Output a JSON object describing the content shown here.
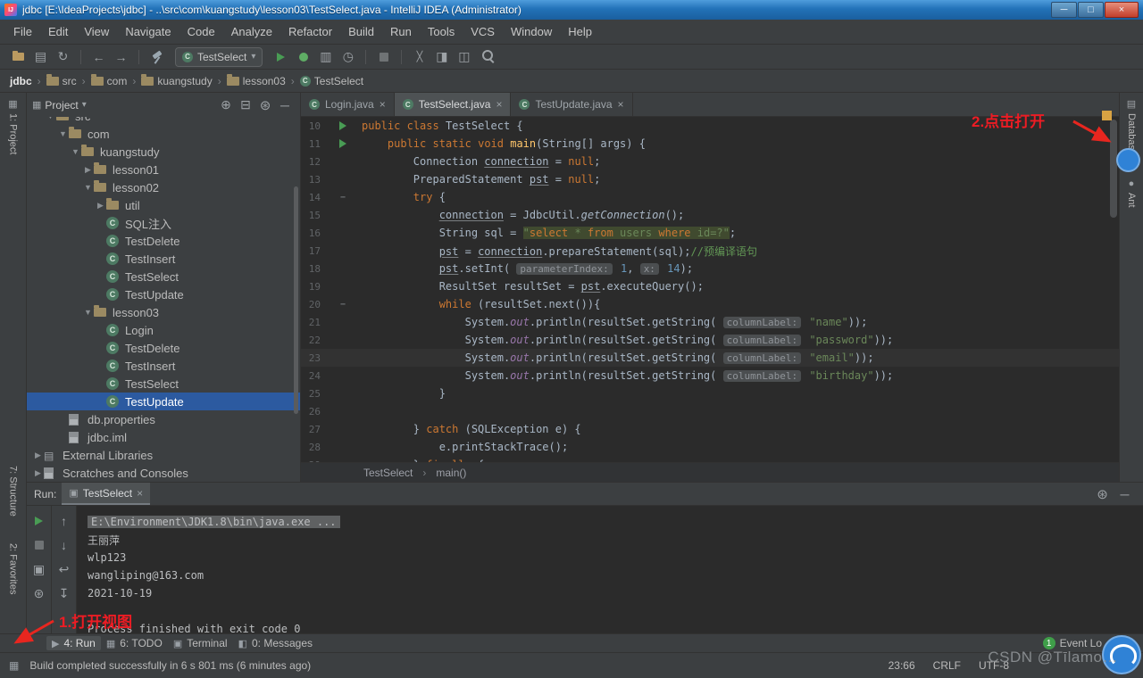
{
  "titlebar": {
    "title": "jdbc [E:\\IdeaProjects\\jdbc] - ..\\src\\com\\kuangstudy\\lesson03\\TestSelect.java - IntelliJ IDEA (Administrator)"
  },
  "menubar": {
    "items": [
      "File",
      "Edit",
      "View",
      "Navigate",
      "Code",
      "Analyze",
      "Refactor",
      "Build",
      "Run",
      "Tools",
      "VCS",
      "Window",
      "Help"
    ]
  },
  "toolbar": {
    "left_icons": [
      "open-folder-icon",
      "save-all-icon",
      "sync-icon"
    ],
    "nav_icons": [
      "back-icon",
      "forward-icon"
    ],
    "build_icons": [
      "hammer-icon"
    ],
    "run_config": "TestSelect",
    "run_icons": [
      "run-icon",
      "debug-icon",
      "coverage-icon",
      "profiler-icon"
    ],
    "stop_icons": [
      "stop-icon"
    ],
    "right_icons": [
      "screwdriver-icon",
      "diff-icon",
      "layout-icon",
      "search-icon"
    ]
  },
  "navbar": {
    "items": [
      {
        "label": "jdbc",
        "icon": "project"
      },
      {
        "label": "src",
        "icon": "folder"
      },
      {
        "label": "com",
        "icon": "folder"
      },
      {
        "label": "kuangstudy",
        "icon": "folder"
      },
      {
        "label": "lesson03",
        "icon": "folder"
      },
      {
        "label": "TestSelect",
        "icon": "class"
      }
    ]
  },
  "left_strip": {
    "items": [
      "1: Project",
      "7: Structure",
      "2: Favorites"
    ]
  },
  "right_strip": {
    "items": [
      "Database",
      "Ant"
    ]
  },
  "project_panel": {
    "title": "Project",
    "header_icons": [
      "locate-icon",
      "collapse-all-icon",
      "gear-icon",
      "hide-icon"
    ],
    "tree": [
      {
        "label": "src",
        "level": 2,
        "arrow": "down",
        "icon": "folder",
        "clipped": true
      },
      {
        "label": "com",
        "level": 3,
        "arrow": "down",
        "icon": "folder"
      },
      {
        "label": "kuangstudy",
        "level": 4,
        "arrow": "down",
        "icon": "folder"
      },
      {
        "label": "lesson01",
        "level": 5,
        "arrow": "right",
        "icon": "folder"
      },
      {
        "label": "lesson02",
        "level": 5,
        "arrow": "down",
        "icon": "folder"
      },
      {
        "label": "util",
        "level": 6,
        "arrow": "right",
        "icon": "folder"
      },
      {
        "label": "SQL注入",
        "level": 6,
        "arrow": "none",
        "icon": "class"
      },
      {
        "label": "TestDelete",
        "level": 6,
        "arrow": "none",
        "icon": "class"
      },
      {
        "label": "TestInsert",
        "level": 6,
        "arrow": "none",
        "icon": "class"
      },
      {
        "label": "TestSelect",
        "level": 6,
        "arrow": "none",
        "icon": "class"
      },
      {
        "label": "TestUpdate",
        "level": 6,
        "arrow": "none",
        "icon": "class"
      },
      {
        "label": "lesson03",
        "level": 5,
        "arrow": "down",
        "icon": "folder"
      },
      {
        "label": "Login",
        "level": 6,
        "arrow": "none",
        "icon": "class"
      },
      {
        "label": "TestDelete",
        "level": 6,
        "arrow": "none",
        "icon": "class"
      },
      {
        "label": "TestInsert",
        "level": 6,
        "arrow": "none",
        "icon": "class"
      },
      {
        "label": "TestSelect",
        "level": 6,
        "arrow": "none",
        "icon": "class"
      },
      {
        "label": "TestUpdate",
        "level": 6,
        "arrow": "none",
        "icon": "class",
        "selected": true
      },
      {
        "label": "db.properties",
        "level": 3,
        "arrow": "none",
        "icon": "file"
      },
      {
        "label": "jdbc.iml",
        "level": 3,
        "arrow": "none",
        "icon": "file"
      },
      {
        "label": "External Libraries",
        "level": 1,
        "arrow": "right",
        "icon": "lib"
      },
      {
        "label": "Scratches and Consoles",
        "level": 1,
        "arrow": "right",
        "icon": "file"
      }
    ]
  },
  "editor": {
    "tabs": [
      {
        "label": "Login.java",
        "active": false
      },
      {
        "label": "TestSelect.java",
        "active": true
      },
      {
        "label": "TestUpdate.java",
        "active": false
      }
    ],
    "breadcrumb": [
      "TestSelect",
      "main()"
    ],
    "lines": [
      {
        "no": 10,
        "g": "run",
        "segs": [
          [
            "k",
            "public"
          ],
          [
            "p",
            " "
          ],
          [
            "k",
            "class"
          ],
          [
            "p",
            " TestSelect {"
          ]
        ]
      },
      {
        "no": 11,
        "g": "run",
        "segs": [
          [
            "p",
            "    "
          ],
          [
            "k",
            "public"
          ],
          [
            "p",
            " "
          ],
          [
            "k",
            "static"
          ],
          [
            "p",
            " "
          ],
          [
            "k",
            "void"
          ],
          [
            "p",
            " "
          ],
          [
            "m",
            "main"
          ],
          [
            "p",
            "(String[] args) {"
          ]
        ]
      },
      {
        "no": 12,
        "g": "",
        "segs": [
          [
            "p",
            "        Connection "
          ],
          [
            "u",
            "connection"
          ],
          [
            "p",
            " = "
          ],
          [
            "k",
            "null"
          ],
          [
            "p",
            ";"
          ]
        ]
      },
      {
        "no": 13,
        "g": "",
        "segs": [
          [
            "p",
            "        PreparedStatement "
          ],
          [
            "u",
            "pst"
          ],
          [
            "p",
            " = "
          ],
          [
            "k",
            "null"
          ],
          [
            "p",
            ";"
          ]
        ]
      },
      {
        "no": 14,
        "g": "fold",
        "segs": [
          [
            "p",
            "        "
          ],
          [
            "k",
            "try"
          ],
          [
            "p",
            " {"
          ]
        ]
      },
      {
        "no": 15,
        "g": "",
        "segs": [
          [
            "p",
            "            "
          ],
          [
            "u",
            "connection"
          ],
          [
            "p",
            " = JdbcUtil."
          ],
          [
            "i",
            "getConnection"
          ],
          [
            "p",
            "();"
          ]
        ]
      },
      {
        "no": 16,
        "g": "",
        "segs": [
          [
            "p",
            "            String sql = "
          ],
          [
            "ss",
            "\""
          ],
          [
            "skw",
            "select"
          ],
          [
            "ss",
            " * "
          ],
          [
            "skw",
            "from"
          ],
          [
            "ss",
            " users "
          ],
          [
            "skw",
            "where"
          ],
          [
            "ss",
            " id=?\""
          ],
          [
            "p",
            ";"
          ]
        ]
      },
      {
        "no": 17,
        "g": "",
        "segs": [
          [
            "p",
            "            "
          ],
          [
            "u",
            "pst"
          ],
          [
            "p",
            " = "
          ],
          [
            "u",
            "connection"
          ],
          [
            "p",
            ".prepareStatement(sql);"
          ],
          [
            "c",
            "//预编译语句"
          ]
        ]
      },
      {
        "no": 18,
        "g": "",
        "segs": [
          [
            "p",
            "            "
          ],
          [
            "u",
            "pst"
          ],
          [
            "p",
            ".setInt( "
          ],
          [
            "h",
            "parameterIndex:"
          ],
          [
            "p",
            " "
          ],
          [
            "n",
            "1"
          ],
          [
            "p",
            ", "
          ],
          [
            "h",
            "x:"
          ],
          [
            "p",
            " "
          ],
          [
            "n",
            "14"
          ],
          [
            "p",
            ");"
          ]
        ]
      },
      {
        "no": 19,
        "g": "",
        "segs": [
          [
            "p",
            "            ResultSet resultSet = "
          ],
          [
            "u",
            "pst"
          ],
          [
            "p",
            ".executeQuery();"
          ]
        ]
      },
      {
        "no": 20,
        "g": "fold",
        "segs": [
          [
            "p",
            "            "
          ],
          [
            "k",
            "while"
          ],
          [
            "p",
            " (resultSet.next()){"
          ]
        ]
      },
      {
        "no": 21,
        "g": "",
        "segs": [
          [
            "p",
            "                System."
          ],
          [
            "f",
            "out"
          ],
          [
            "p",
            ".println(resultSet.getString( "
          ],
          [
            "h",
            "columnLabel:"
          ],
          [
            "p",
            " "
          ],
          [
            "s",
            "\"name\""
          ],
          [
            "p",
            "));"
          ]
        ]
      },
      {
        "no": 22,
        "g": "",
        "segs": [
          [
            "p",
            "                System."
          ],
          [
            "f",
            "out"
          ],
          [
            "p",
            ".println(resultSet.getString( "
          ],
          [
            "h",
            "columnLabel:"
          ],
          [
            "p",
            " "
          ],
          [
            "s",
            "\"password\""
          ],
          [
            "p",
            "));"
          ]
        ]
      },
      {
        "no": 23,
        "g": "",
        "cur": true,
        "segs": [
          [
            "p",
            "                System."
          ],
          [
            "f",
            "out"
          ],
          [
            "p",
            ".println(resultSet.getString( "
          ],
          [
            "h",
            "columnLabel:"
          ],
          [
            "p",
            " "
          ],
          [
            "s",
            "\"email\""
          ],
          [
            "p",
            "));"
          ]
        ]
      },
      {
        "no": 24,
        "g": "",
        "segs": [
          [
            "p",
            "                System."
          ],
          [
            "f",
            "out"
          ],
          [
            "p",
            ".println(resultSet.getString( "
          ],
          [
            "h",
            "columnLabel:"
          ],
          [
            "p",
            " "
          ],
          [
            "s",
            "\"birthday\""
          ],
          [
            "p",
            "));"
          ]
        ]
      },
      {
        "no": 25,
        "g": "",
        "segs": [
          [
            "p",
            "            }"
          ]
        ]
      },
      {
        "no": 26,
        "g": "",
        "segs": []
      },
      {
        "no": 27,
        "g": "",
        "segs": [
          [
            "p",
            "        } "
          ],
          [
            "k",
            "catch"
          ],
          [
            "p",
            " (SQLException e) {"
          ]
        ]
      },
      {
        "no": 28,
        "g": "",
        "segs": [
          [
            "p",
            "            e.printStackTrace();"
          ]
        ]
      },
      {
        "no": 29,
        "g": "",
        "segs": [
          [
            "p",
            "        } "
          ],
          [
            "k",
            "finally"
          ],
          [
            "p",
            " {"
          ]
        ]
      }
    ]
  },
  "run_panel": {
    "label": "Run:",
    "tab": "TestSelect",
    "header_icons": [
      "gear-icon",
      "hide-icon"
    ],
    "left_icons": [
      "rerun-icon",
      "stop-icon",
      "camera-icon",
      "settings-icon"
    ],
    "console_icons": [
      "up-icon",
      "down-icon",
      "softwrap-icon",
      "scroll-end-icon"
    ],
    "console": [
      "E:\\Environment\\JDK1.8\\bin\\java.exe ...",
      "王丽萍",
      "wlp123",
      "wangliping@163.com",
      "2021-10-19",
      "",
      "Process finished with exit code 0"
    ]
  },
  "bottom_bar": {
    "items": [
      {
        "label": "4: Run",
        "icon": "run-small-icon",
        "active": true
      },
      {
        "label": "6: TODO",
        "icon": "todo-icon",
        "active": false
      },
      {
        "label": "Terminal",
        "icon": "terminal-icon",
        "active": false
      },
      {
        "label": "0: Messages",
        "icon": "messages-icon",
        "active": false
      }
    ],
    "event_log": {
      "count": "1",
      "label": "Event Lo"
    }
  },
  "status_bar": {
    "message": "Build completed successfully in 6 s 801 ms (6 minutes ago)",
    "position": "23:66",
    "line_ending": "CRLF",
    "encoding": "UTF-8"
  },
  "annotations": {
    "open_panel": "2.点击打开",
    "open_view": "1.打开视图"
  },
  "watermark": {
    "text": "CSDN @Tīlamo…"
  }
}
